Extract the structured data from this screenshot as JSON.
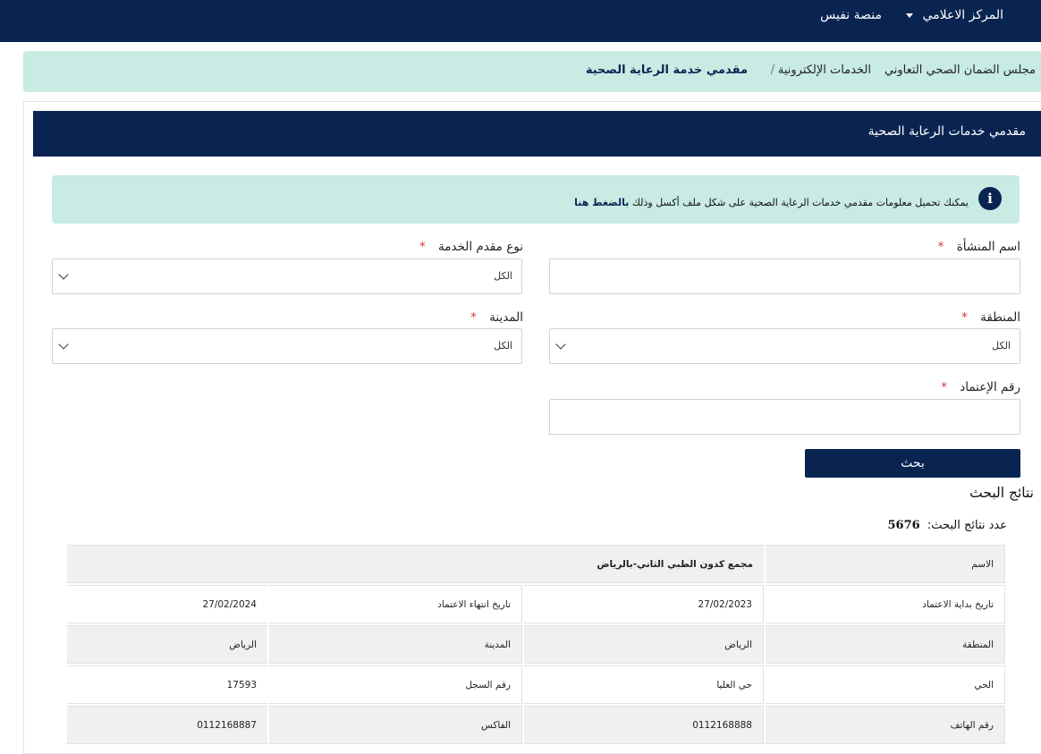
{
  "topbar": {
    "media_center": "المركز الاعلامي",
    "nafees": "منصة نفيس"
  },
  "breadcrumb": {
    "root": "مجلس الضمان الصحي التعاوني",
    "eservices": "الخدمات الإلكترونية",
    "separator": "/",
    "current": "مقدمي خدمة الرعاية الصحية"
  },
  "card": {
    "title": "مقدمي خدمات الرعاية الصحية"
  },
  "info": {
    "text": "يمكنك تحميل معلومات مقدمي خدمات الرعاية الصحية على شكل ملف أكسل وذلك",
    "link": "بالضغط هنا",
    "icon": "info-icon"
  },
  "form": {
    "facility_name": {
      "label": "اسم المنشأة",
      "required": "*",
      "value": ""
    },
    "provider_type": {
      "label": "نوع مقدم الخدمة",
      "required": "*",
      "selected": "الكل"
    },
    "region": {
      "label": "المنطقة",
      "required": "*",
      "selected": "الكل"
    },
    "city": {
      "label": "المدينة",
      "required": "*",
      "selected": "الكل"
    },
    "accreditation_no": {
      "label": "رقم الإعتماد",
      "required": "*",
      "value": ""
    },
    "search_label": "بحث"
  },
  "results": {
    "title": "نتائج البحث",
    "count_label": "عدد نتائج البحث:",
    "count": "5676",
    "name_label": "الاسم",
    "name_value": "مجمع كدون الطبي الثاني-بالرياض",
    "rows": [
      {
        "l1": "تاريخ بداية الاعتماد",
        "v1": "27/02/2023",
        "l2": "تاريخ انتهاء الاعتماد",
        "v2": "27/02/2024"
      },
      {
        "l1": "المنطقة",
        "v1": "الرياض",
        "l2": "المدينة",
        "v2": "الرياض"
      },
      {
        "l1": "الحي",
        "v1": "حي العليا",
        "l2": "رقم السجل",
        "v2": "17593"
      },
      {
        "l1": "رقم الهاتف",
        "v1": "0112168888",
        "l2": "الفاكس",
        "v2": "0112168887"
      }
    ]
  },
  "colors": {
    "navy": "#0a2452",
    "mint": "#c8ebe4",
    "required": "#d9343a"
  }
}
